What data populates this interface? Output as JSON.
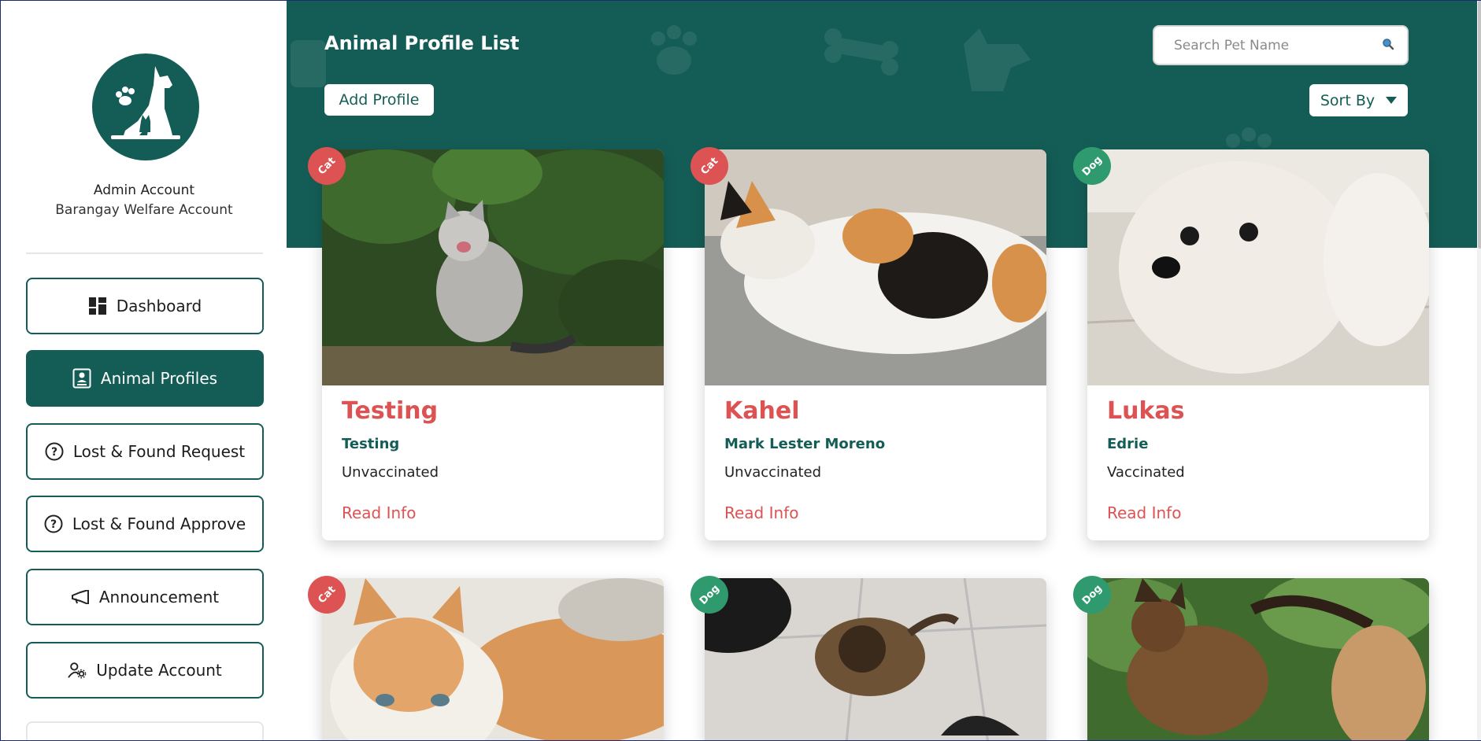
{
  "sidebar": {
    "account_name": "Admin Account",
    "account_subtitle": "Barangay Welfare Account",
    "logo_icon": "pet-shelter-logo",
    "items": [
      {
        "label": "Dashboard",
        "icon": "dashboard-icon",
        "active": false
      },
      {
        "label": "Animal Profiles",
        "icon": "profile-icon",
        "active": true
      },
      {
        "label": "Lost & Found Request",
        "icon": "question-circle-icon",
        "active": false
      },
      {
        "label": "Lost & Found Approve",
        "icon": "question-circle-icon",
        "active": false
      },
      {
        "label": "Announcement",
        "icon": "megaphone-icon",
        "active": false
      },
      {
        "label": "Update Account",
        "icon": "user-gear-icon",
        "active": false
      }
    ]
  },
  "header": {
    "title": "Animal Profile List",
    "add_button": "Add Profile",
    "search_placeholder": "Search Pet Name",
    "search_icon": "search-icon",
    "sort_label": "Sort By"
  },
  "colors": {
    "primary": "#145d56",
    "accent": "#dd5252",
    "dog_badge": "#2f9a6d"
  },
  "cards": [
    {
      "species": "Cat",
      "name": "Testing",
      "owner": "Testing",
      "status": "Unvaccinated",
      "action": "Read Info"
    },
    {
      "species": "Cat",
      "name": "Kahel",
      "owner": "Mark Lester Moreno",
      "status": "Unvaccinated",
      "action": "Read Info"
    },
    {
      "species": "Dog",
      "name": "Lukas",
      "owner": "Edrie",
      "status": "Vaccinated",
      "action": "Read Info"
    },
    {
      "species": "Cat"
    },
    {
      "species": "Dog"
    },
    {
      "species": "Dog"
    }
  ]
}
